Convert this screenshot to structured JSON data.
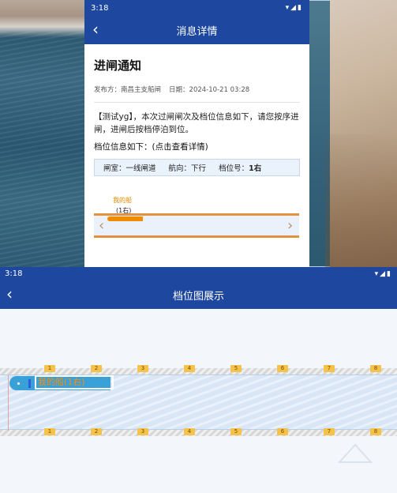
{
  "top_phone": {
    "status_time": "3:18",
    "header_title": "消息详情",
    "message": {
      "title": "进闸通知",
      "publisher_label": "发布方：",
      "publisher": "南昌主支船闸",
      "date_label": "日期：",
      "date": "2024-10-21 03:28",
      "body": "【测试yg】，本次过闸闸次及档位信息如下，请您按序进闸，进闸后按档停泊到位。",
      "berth_heading": "档位信息如下：(点击查看详情)",
      "berth_info": {
        "chamber_label": "闸室：",
        "chamber": "一线闸道",
        "direction_label": "航向：",
        "direction": "下行",
        "slot_label": "档位号：",
        "slot": "1右"
      }
    },
    "mini_map": {
      "ship_name": "我的船",
      "ship_slot": "(1右)"
    }
  },
  "bottom_screen": {
    "status_time": "3:18",
    "header_title": "档位图展示",
    "ship_tag": "我的船(1右)",
    "berth_marks": [
      "1",
      "2",
      "3",
      "4",
      "5",
      "6",
      "7",
      "8"
    ]
  },
  "colors": {
    "header_blue": "#1e48a0",
    "ship_orange": "#f08c00",
    "ship_blue": "#3aa0d8",
    "mark_yellow": "#f5c24a"
  }
}
